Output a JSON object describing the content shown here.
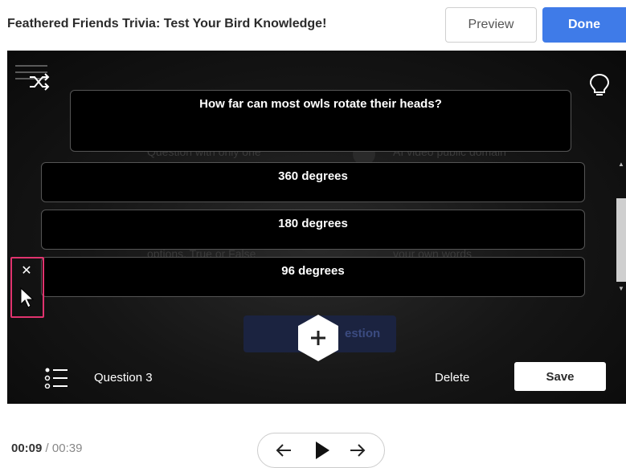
{
  "header": {
    "title": "Feathered Friends Trivia: Test Your Bird Knowledge!",
    "preview_label": "Preview",
    "done_label": "Done"
  },
  "editor": {
    "question": "How far can most owls rotate their heads?",
    "answers": [
      "360 degrees",
      "180 degrees",
      "96 degrees"
    ],
    "ghost_texts": {
      "left_option": "Question with only one",
      "right_option": "AI video public domain",
      "left_sub": "options, True or False",
      "right_sub": "your own words",
      "add_label": "estion"
    },
    "question_label": "Question 3",
    "delete_label": "Delete",
    "save_label": "Save"
  },
  "playback": {
    "current_time": "00:09",
    "separator": "/",
    "total_time": "00:39"
  },
  "colors": {
    "done_button": "#3f7be8",
    "highlight_border": "#e0336e"
  },
  "icons": [
    "shuffle-icon",
    "lightbulb-icon",
    "close-icon",
    "cursor-icon",
    "plus-icon",
    "list-icon",
    "arrow-left-icon",
    "play-icon",
    "arrow-right-icon"
  ]
}
